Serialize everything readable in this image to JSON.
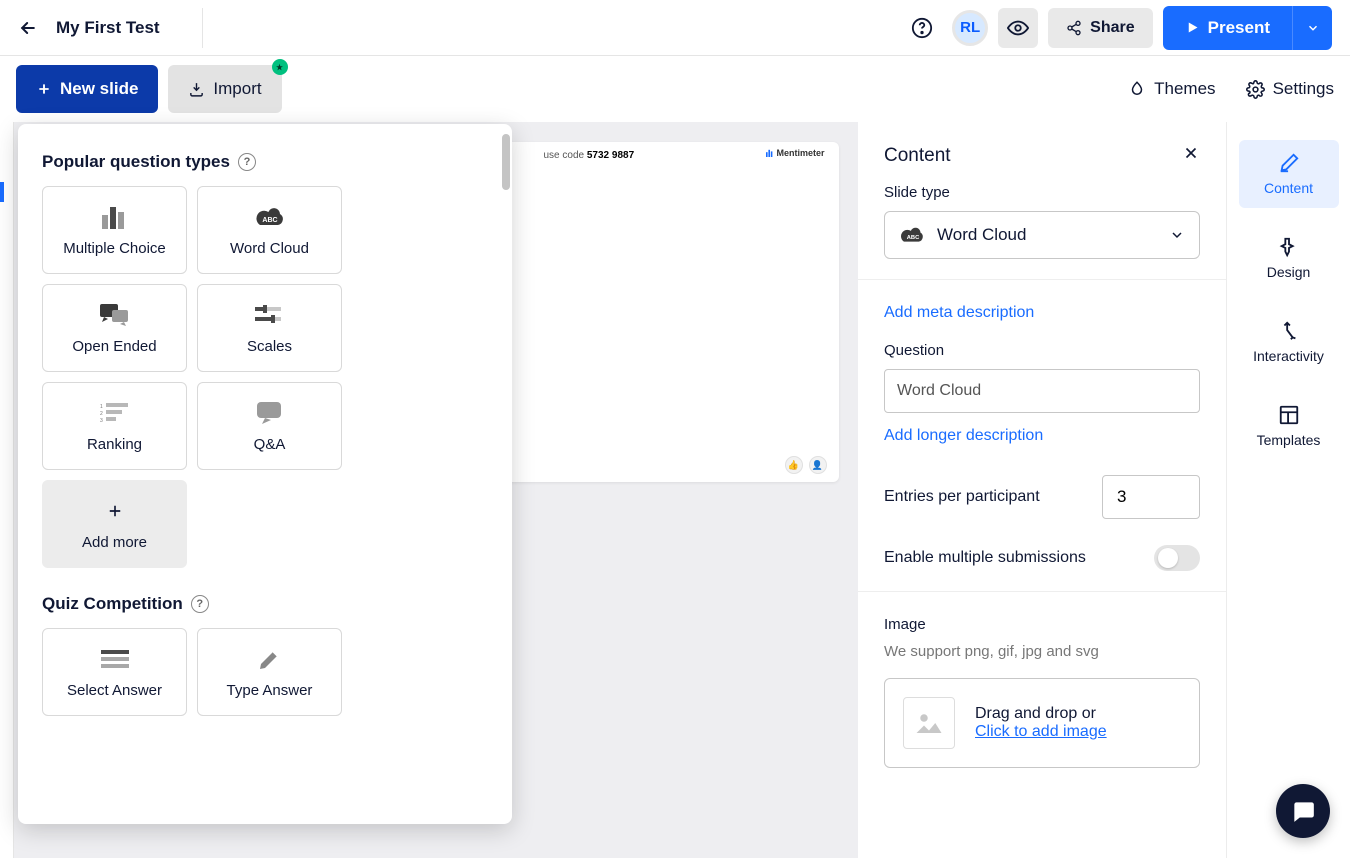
{
  "header": {
    "title": "My First Test",
    "avatar": "RL",
    "share_label": "Share",
    "present_label": "Present"
  },
  "toolbar": {
    "new_slide_label": "New slide",
    "import_label": "Import",
    "themes_label": "Themes",
    "settings_label": "Settings"
  },
  "popover": {
    "section1_title": "Popular question types",
    "tiles": [
      "Multiple Choice",
      "Word Cloud",
      "Open Ended",
      "Scales",
      "Ranking",
      "Q&A",
      "Add more"
    ],
    "section2_title": "Quiz Competition",
    "quiz_tiles": [
      "Select Answer",
      "Type Answer"
    ]
  },
  "slide": {
    "code_prefix": "use code",
    "code": "5732 9887",
    "brand": "Mentimeter"
  },
  "content_panel": {
    "title": "Content",
    "slide_type_label": "Slide type",
    "slide_type_value": "Word Cloud",
    "add_meta_link": "Add meta description",
    "question_label": "Question",
    "question_value": "Word Cloud",
    "longer_desc_link": "Add longer description",
    "entries_label": "Entries per participant",
    "entries_value": "3",
    "multi_sub_label": "Enable multiple submissions",
    "image_label": "Image",
    "image_subtext": "We support png, gif, jpg and svg",
    "image_drop_text": "Drag and drop or",
    "image_drop_link": "Click to add image"
  },
  "rail": {
    "tabs": [
      "Content",
      "Design",
      "Interactivity",
      "Templates"
    ]
  }
}
